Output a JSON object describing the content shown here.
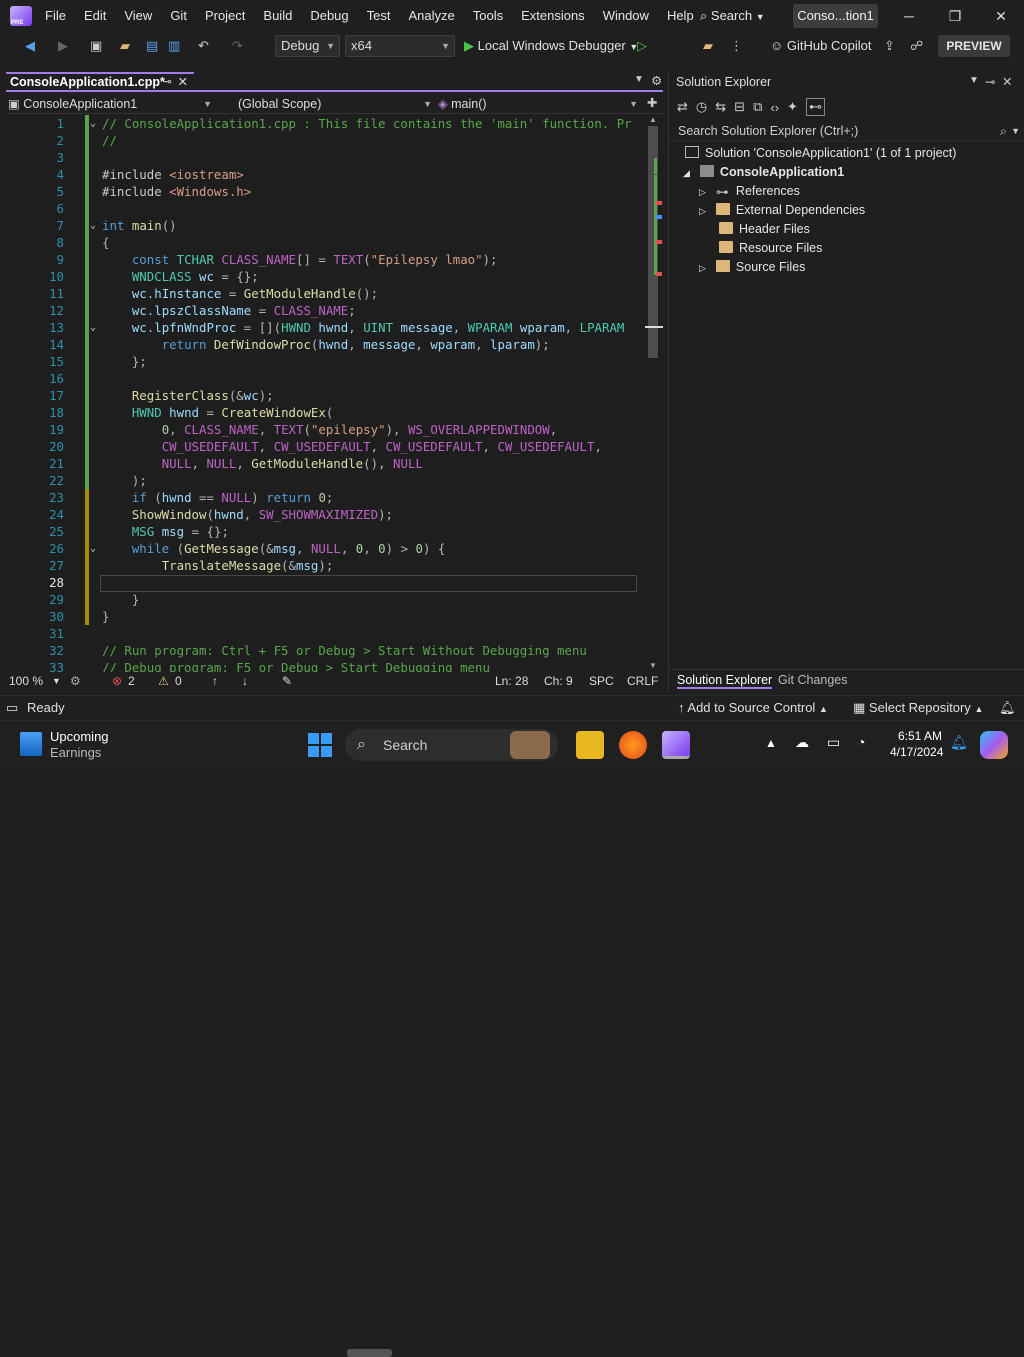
{
  "menu": [
    "File",
    "Edit",
    "View",
    "Git",
    "Project",
    "Build",
    "Debug",
    "Test",
    "Analyze",
    "Tools",
    "Extensions",
    "Window",
    "Help"
  ],
  "search_label": "Search",
  "solution_badge": "Conso...tion1",
  "toolbar": {
    "config": "Debug",
    "platform": "x64",
    "run_label": "Local Windows Debugger",
    "copilot": "GitHub Copilot",
    "preview": "PREVIEW"
  },
  "editor": {
    "tab_label": "ConsoleApplication1.cpp*",
    "project_combo": "ConsoleApplication1",
    "scope_combo": "(Global Scope)",
    "member_combo": "main()",
    "status": {
      "zoom": "100 %",
      "errors": "2",
      "warnings": "0",
      "line": "Ln: 28",
      "col": "Ch: 9",
      "spacing": "SPC",
      "eol": "CRLF"
    }
  },
  "code": [
    {
      "n": "1",
      "t": "// ConsoleApplication1.cpp : This file contains the 'main' function. Pr"
    },
    {
      "n": "2",
      "t": "//"
    },
    {
      "n": "3",
      "t": ""
    },
    {
      "n": "4",
      "t": "#include <iostream>"
    },
    {
      "n": "5",
      "t": "#include <Windows.h>"
    },
    {
      "n": "6",
      "t": ""
    },
    {
      "n": "7",
      "t": "int main()"
    },
    {
      "n": "8",
      "t": "{"
    },
    {
      "n": "9",
      "t": "    const TCHAR CLASS_NAME[] = TEXT(\"Epilepsy lmao\");"
    },
    {
      "n": "10",
      "t": "    WNDCLASS wc = {};"
    },
    {
      "n": "11",
      "t": "    wc.hInstance = GetModuleHandle();"
    },
    {
      "n": "12",
      "t": "    wc.lpszClassName = CLASS_NAME;"
    },
    {
      "n": "13",
      "t": "    wc.lpfnWndProc = [](HWND hwnd, UINT message, WPARAM wparam, LPARAM"
    },
    {
      "n": "14",
      "t": "        return DefWindowProc(hwnd, message, wparam, lparam);"
    },
    {
      "n": "15",
      "t": "    };"
    },
    {
      "n": "16",
      "t": ""
    },
    {
      "n": "17",
      "t": "    RegisterClass(&wc);"
    },
    {
      "n": "18",
      "t": "    HWND hwnd = CreateWindowEx("
    },
    {
      "n": "19",
      "t": "        0, CLASS_NAME, TEXT(\"epilepsy\"), WS_OVERLAPPEDWINDOW,"
    },
    {
      "n": "20",
      "t": "        CW_USEDEFAULT, CW_USEDEFAULT, CW_USEDEFAULT, CW_USEDEFAULT,"
    },
    {
      "n": "21",
      "t": "        NULL, NULL, GetModuleHandle(), NULL"
    },
    {
      "n": "22",
      "t": "    );"
    },
    {
      "n": "23",
      "t": "    if (hwnd == NULL) return 0;"
    },
    {
      "n": "24",
      "t": "    ShowWindow(hwnd, SW_SHOWMAXIMIZED);"
    },
    {
      "n": "25",
      "t": "    MSG msg = {};"
    },
    {
      "n": "26",
      "t": "    while (GetMessage(&msg, NULL, 0, 0) > 0) {"
    },
    {
      "n": "27",
      "t": "        TranslateMessage(&msg);"
    },
    {
      "n": "28",
      "t": ""
    },
    {
      "n": "29",
      "t": "    }"
    },
    {
      "n": "30",
      "t": "}"
    },
    {
      "n": "31",
      "t": ""
    },
    {
      "n": "32",
      "t": "// Run program: Ctrl + F5 or Debug > Start Without Debugging menu"
    },
    {
      "n": "33",
      "t": "// Debug program: F5 or Debug > Start Debugging menu"
    }
  ],
  "solution_explorer": {
    "title": "Solution Explorer",
    "search_placeholder": "Search Solution Explorer (Ctrl+;)",
    "solution": "Solution 'ConsoleApplication1' (1 of 1 project)",
    "project": "ConsoleApplication1",
    "items": [
      "References",
      "External Dependencies",
      "Header Files",
      "Resource Files",
      "Source Files"
    ],
    "tab_active": "Solution Explorer",
    "tab_other": "Git Changes"
  },
  "statusbar": {
    "ready": "Ready",
    "source_control": "Add to Source Control",
    "repository": "Select Repository"
  },
  "taskbar": {
    "weather_title": "Upcoming",
    "weather_sub": "Earnings",
    "search": "Search",
    "time": "6:51 AM",
    "date": "4/17/2024"
  }
}
